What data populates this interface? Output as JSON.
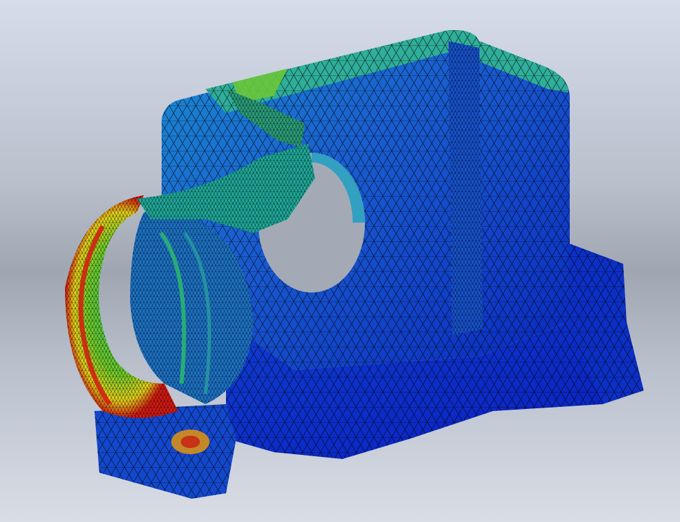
{
  "viewport": {
    "kind": "fea-stress-plot",
    "mesh_visible": true,
    "colormap": [
      "#0a1fbf",
      "#1a5fd0",
      "#21a7c9",
      "#2ebf6a",
      "#8fd21e",
      "#e8d21a",
      "#e8641a",
      "#d41a12"
    ],
    "background_colors": [
      "#d6dcea",
      "#9fa6b2",
      "#d9dde6"
    ]
  }
}
